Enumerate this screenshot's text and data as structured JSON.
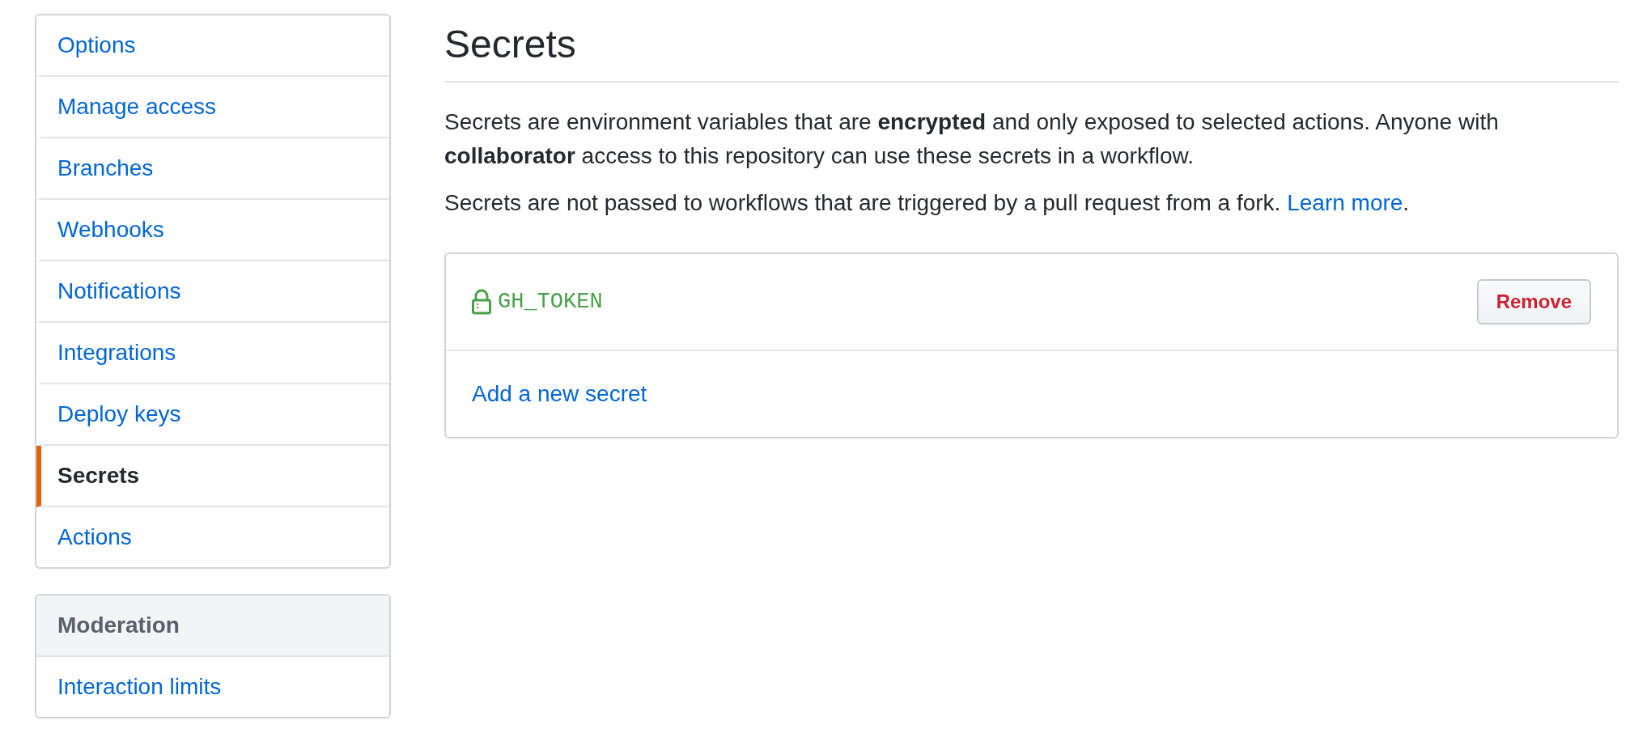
{
  "sidebar": {
    "items": [
      {
        "label": "Options",
        "selected": false
      },
      {
        "label": "Manage access",
        "selected": false
      },
      {
        "label": "Branches",
        "selected": false
      },
      {
        "label": "Webhooks",
        "selected": false
      },
      {
        "label": "Notifications",
        "selected": false
      },
      {
        "label": "Integrations",
        "selected": false
      },
      {
        "label": "Deploy keys",
        "selected": false
      },
      {
        "label": "Secrets",
        "selected": true
      },
      {
        "label": "Actions",
        "selected": false
      }
    ]
  },
  "moderation": {
    "heading": "Moderation",
    "items": [
      {
        "label": "Interaction limits",
        "selected": false
      }
    ]
  },
  "page_title": "Secrets",
  "description": "Secrets are environment variables that are **encrypted** and only exposed to selected actions. Anyone with **collaborator** access to this repository can use these secrets in a workflow.",
  "note": {
    "text": "Secrets are not passed to workflows that are triggered by a pull request from a fork.",
    "link": "Learn more",
    "end": "."
  },
  "secrets": [
    {
      "name": "GH_TOKEN",
      "button": "Remove"
    }
  ],
  "add_link": "Add a new secret"
}
